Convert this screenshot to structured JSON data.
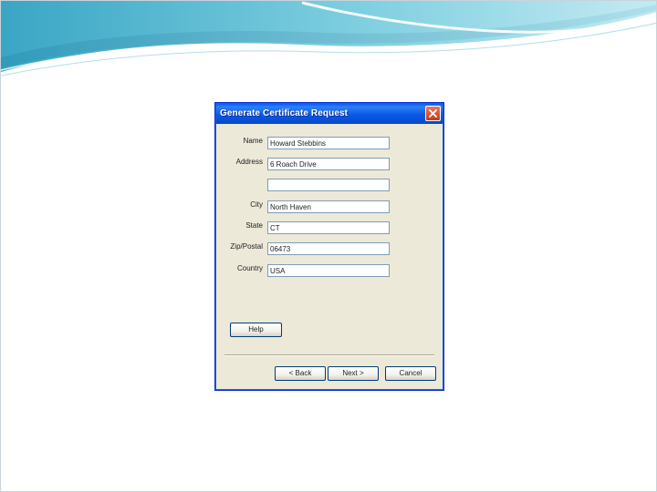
{
  "dialog": {
    "title": "Generate Certificate Request",
    "close_icon": "close-icon"
  },
  "form": {
    "name": {
      "label": "Name",
      "value": "Howard Stebbins"
    },
    "address": {
      "label": "Address",
      "value": "6 Roach Drive"
    },
    "address2": {
      "value": ""
    },
    "city": {
      "label": "City",
      "value": "North Haven"
    },
    "state": {
      "label": "State",
      "value": "CT"
    },
    "zip": {
      "label": "Zip/Postal",
      "value": "06473"
    },
    "country": {
      "label": "Country",
      "value": "USA"
    }
  },
  "buttons": {
    "help": "Help",
    "back": "< Back",
    "next": "Next >",
    "cancel": "Cancel"
  },
  "colors": {
    "titlebar": "#0b58e6",
    "dialog_bg": "#ece9d8",
    "swoosh_teal": "#4fb6cf",
    "swoosh_light": "#bfe6ef"
  }
}
